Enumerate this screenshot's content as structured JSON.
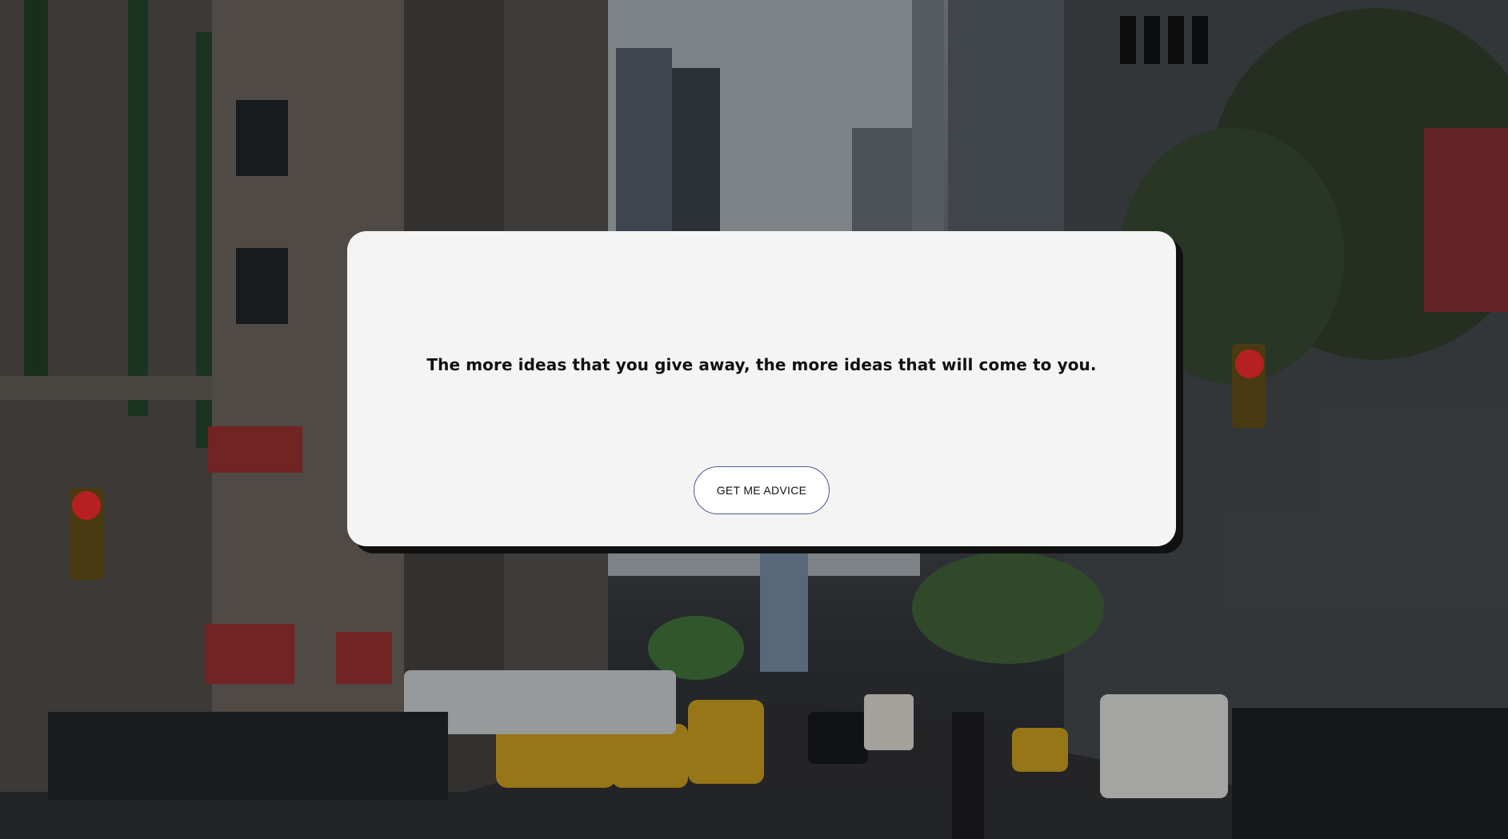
{
  "advice": {
    "quote": "The more ideas that you give away, the more ideas that will come to you.",
    "button_label": "GET ME ADVICE"
  },
  "background": {
    "description_icon": "city-street-photo"
  }
}
